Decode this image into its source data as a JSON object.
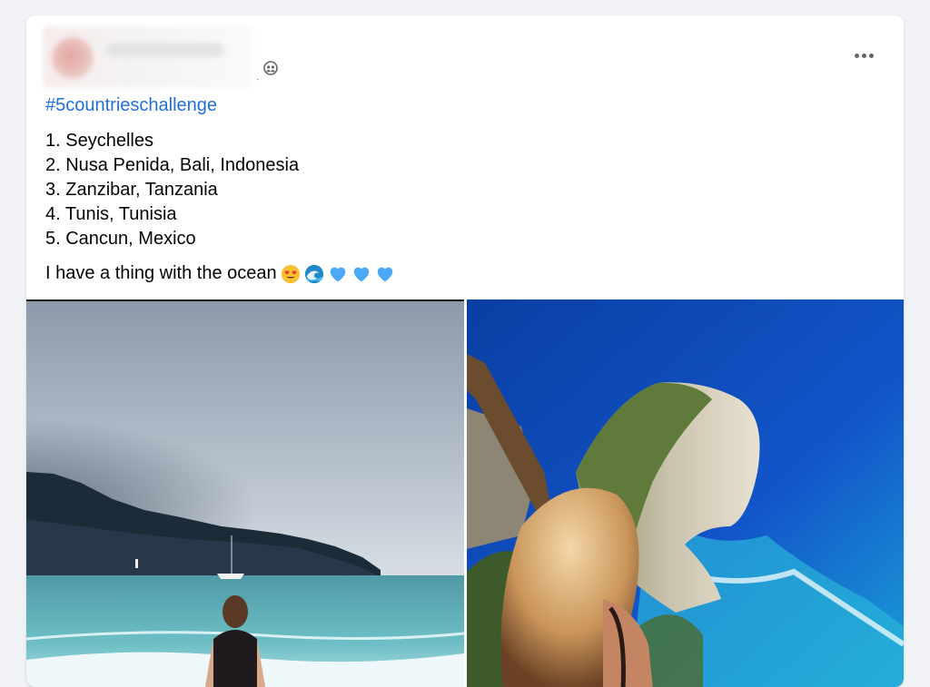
{
  "post": {
    "hashtag": "#5countrieschallenge",
    "list": [
      "1. Seychelles",
      "2. Nusa Penida, Bali, Indonesia",
      "3. Zanzibar, Tanzania",
      "4. Tunis, Tunisia",
      "5. Cancun, Mexico"
    ],
    "tagline": "I have a thing with the ocean",
    "tagline_emojis": [
      "heart-eyes-emoji",
      "wave-emoji",
      "blue-heart-emoji",
      "blue-heart-emoji",
      "blue-heart-emoji"
    ],
    "audience_icon": "friends-icon",
    "menu_icon": "more-options-icon"
  },
  "photos": [
    {
      "id": "seychelles-beach",
      "alt": ""
    },
    {
      "id": "nusa-penida-cliff",
      "alt": ""
    }
  ],
  "colors": {
    "background": "#f0f2f5",
    "card": "#ffffff",
    "hashtag": "#216fdb",
    "secondary_text": "#65676b",
    "emoji_yellow": "#fbc02d",
    "heart_blue": "#4aa8f5"
  }
}
